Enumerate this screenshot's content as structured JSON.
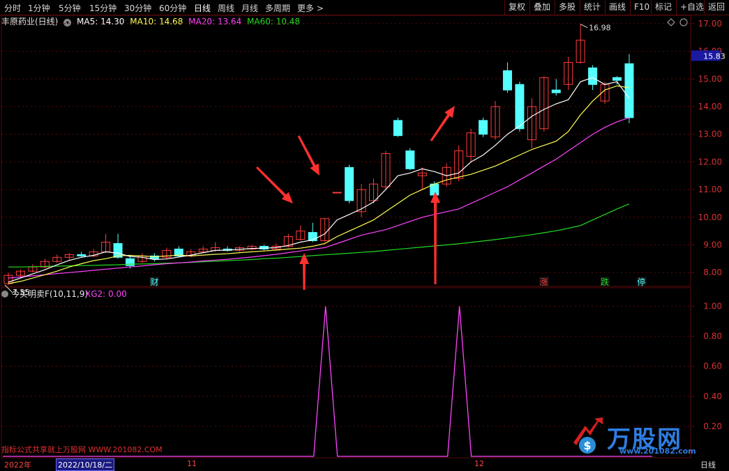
{
  "toolbar": {
    "tabs": [
      "分时",
      "1分钟",
      "5分钟",
      "15分钟",
      "30分钟",
      "60分钟",
      "日线",
      "周线",
      "月线",
      "多周期",
      "更多 >"
    ],
    "active_tab": "日线",
    "right_buttons": [
      "复权",
      "叠加",
      "多股",
      "统计",
      "画线",
      "F10",
      "标记",
      "+自选",
      "返回"
    ]
  },
  "info": {
    "stock_name": "丰原药业(日线)",
    "ma5": "MA5: 14.30",
    "ma10": "MA10: 14.68",
    "ma20": "MA20: 13.64",
    "ma60": "MA60: 10.48"
  },
  "indicator": {
    "name": "今买明卖F(10,11,9)",
    "series_label": "XG2: 0.00"
  },
  "colors": {
    "up": "#ff3c3c",
    "down": "#54ffff",
    "ma5": "#ffffff",
    "ma10": "#ffff55",
    "ma20": "#ff44ff",
    "ma60": "#22dd22",
    "grid": "#5a0a0a",
    "arrow": "#ff3030"
  },
  "promo_text": "指标公式共享就上万股网 WWW.201082.COM",
  "watermark": {
    "brand": "万股网",
    "url": "www.201082.com"
  },
  "bottom": {
    "year": "2022年",
    "date": "2022/10/18/二",
    "m11": "11",
    "m12": "12",
    "period": "日线"
  },
  "chart_data": {
    "type": "candlestick",
    "price_axis": {
      "ylim": [
        7.5,
        17.3
      ],
      "ticks": [
        "17.00",
        "16.00",
        "15.00",
        "14.00",
        "13.00",
        "12.00",
        "11.00",
        "10.00",
        "9.00",
        "8.00"
      ]
    },
    "current_price": "15.83",
    "high_label": "16.98",
    "low_label": "7.55",
    "candles": [
      {
        "o": 7.6,
        "c": 7.9,
        "h": 8.0,
        "l": 7.55
      },
      {
        "o": 7.9,
        "c": 8.05,
        "h": 8.1,
        "l": 7.85
      },
      {
        "o": 8.05,
        "c": 8.2,
        "h": 8.3,
        "l": 8.0
      },
      {
        "o": 8.2,
        "c": 8.4,
        "h": 8.5,
        "l": 8.15
      },
      {
        "o": 8.4,
        "c": 8.55,
        "h": 8.65,
        "l": 8.35
      },
      {
        "o": 8.55,
        "c": 8.65,
        "h": 8.7,
        "l": 8.45
      },
      {
        "o": 8.65,
        "c": 8.6,
        "h": 8.75,
        "l": 8.55
      },
      {
        "o": 8.6,
        "c": 8.75,
        "h": 8.85,
        "l": 8.55
      },
      {
        "o": 8.75,
        "c": 9.1,
        "h": 9.4,
        "l": 8.7
      },
      {
        "o": 9.05,
        "c": 8.55,
        "h": 9.4,
        "l": 8.5
      },
      {
        "o": 8.5,
        "c": 8.25,
        "h": 8.6,
        "l": 8.15
      },
      {
        "o": 8.4,
        "c": 8.6,
        "h": 8.7,
        "l": 8.35
      },
      {
        "o": 8.6,
        "c": 8.5,
        "h": 8.7,
        "l": 8.4
      },
      {
        "o": 8.55,
        "c": 8.8,
        "h": 8.9,
        "l": 8.5
      },
      {
        "o": 8.85,
        "c": 8.6,
        "h": 8.95,
        "l": 8.55
      },
      {
        "o": 8.6,
        "c": 8.75,
        "h": 8.85,
        "l": 8.55
      },
      {
        "o": 8.75,
        "c": 8.85,
        "h": 8.95,
        "l": 8.7
      },
      {
        "o": 8.8,
        "c": 8.9,
        "h": 9.1,
        "l": 8.75
      },
      {
        "o": 8.85,
        "c": 8.8,
        "h": 8.95,
        "l": 8.75
      },
      {
        "o": 8.8,
        "c": 8.9,
        "h": 8.95,
        "l": 8.75
      },
      {
        "o": 8.85,
        "c": 8.95,
        "h": 9.0,
        "l": 8.8
      },
      {
        "o": 8.95,
        "c": 8.85,
        "h": 9.0,
        "l": 8.8
      },
      {
        "o": 8.85,
        "c": 8.95,
        "h": 9.05,
        "l": 8.8
      },
      {
        "o": 8.95,
        "c": 9.3,
        "h": 9.4,
        "l": 8.9
      },
      {
        "o": 9.2,
        "c": 9.5,
        "h": 9.7,
        "l": 9.15
      },
      {
        "o": 9.45,
        "c": 9.15,
        "h": 9.8,
        "l": 9.1
      },
      {
        "o": 9.15,
        "c": 9.95,
        "h": 9.95,
        "l": 9.1
      },
      {
        "o": 10.9,
        "c": 10.9,
        "h": 10.9,
        "l": 10.9
      },
      {
        "o": 11.8,
        "c": 10.6,
        "h": 11.9,
        "l": 10.5
      },
      {
        "o": 10.2,
        "c": 11.0,
        "h": 11.2,
        "l": 10.0
      },
      {
        "o": 10.6,
        "c": 11.2,
        "h": 11.4,
        "l": 10.5
      },
      {
        "o": 11.1,
        "c": 12.3,
        "h": 12.4,
        "l": 11.0
      },
      {
        "o": 13.5,
        "c": 12.95,
        "h": 13.6,
        "l": 12.9
      },
      {
        "o": 12.4,
        "c": 11.75,
        "h": 12.5,
        "l": 11.7
      },
      {
        "o": 11.5,
        "c": 11.6,
        "h": 11.8,
        "l": 11.0
      },
      {
        "o": 11.2,
        "c": 10.8,
        "h": 11.3,
        "l": 10.4
      },
      {
        "o": 11.2,
        "c": 11.8,
        "h": 11.95,
        "l": 11.1
      },
      {
        "o": 11.4,
        "c": 12.4,
        "h": 12.6,
        "l": 11.3
      },
      {
        "o": 12.2,
        "c": 13.05,
        "h": 13.2,
        "l": 12.0
      },
      {
        "o": 13.5,
        "c": 13.0,
        "h": 13.6,
        "l": 12.9
      },
      {
        "o": 12.9,
        "c": 14.0,
        "h": 14.2,
        "l": 12.8
      },
      {
        "o": 15.3,
        "c": 14.6,
        "h": 15.6,
        "l": 14.5
      },
      {
        "o": 14.8,
        "c": 13.2,
        "h": 14.9,
        "l": 13.1
      },
      {
        "o": 12.8,
        "c": 14.0,
        "h": 14.3,
        "l": 12.5
      },
      {
        "o": 13.2,
        "c": 15.05,
        "h": 15.1,
        "l": 13.1
      },
      {
        "o": 14.6,
        "c": 14.5,
        "h": 15.0,
        "l": 14.4
      },
      {
        "o": 14.8,
        "c": 15.6,
        "h": 15.8,
        "l": 14.6
      },
      {
        "o": 15.6,
        "c": 16.4,
        "h": 16.98,
        "l": 15.55
      },
      {
        "o": 15.4,
        "c": 14.8,
        "h": 15.5,
        "l": 14.6
      },
      {
        "o": 14.2,
        "c": 14.8,
        "h": 14.9,
        "l": 14.1
      },
      {
        "o": 15.05,
        "c": 14.95,
        "h": 15.1,
        "l": 14.8
      },
      {
        "o": 15.55,
        "c": 13.6,
        "h": 15.9,
        "l": 13.4
      }
    ],
    "ma5": [
      7.65,
      7.8,
      7.95,
      8.1,
      8.28,
      8.44,
      8.55,
      8.62,
      8.75,
      8.7,
      8.58,
      8.55,
      8.47,
      8.49,
      8.56,
      8.63,
      8.72,
      8.8,
      8.81,
      8.84,
      8.87,
      8.88,
      8.9,
      8.98,
      9.1,
      9.18,
      9.4,
      9.9,
      10.1,
      10.3,
      10.55,
      11.0,
      11.5,
      11.6,
      11.75,
      11.65,
      11.5,
      11.6,
      12.0,
      12.25,
      12.6,
      13.0,
      13.3,
      13.65,
      13.9,
      14.1,
      14.25,
      14.9,
      15.05,
      14.8,
      14.9,
      14.3
    ],
    "ma10": [
      7.6,
      7.68,
      7.8,
      7.92,
      8.05,
      8.2,
      8.32,
      8.43,
      8.5,
      8.6,
      8.62,
      8.6,
      8.57,
      8.6,
      8.63,
      8.6,
      8.63,
      8.66,
      8.68,
      8.72,
      8.75,
      8.78,
      8.81,
      8.85,
      8.88,
      8.95,
      9.05,
      9.3,
      9.5,
      9.7,
      9.9,
      10.2,
      10.5,
      10.8,
      11.0,
      11.2,
      11.35,
      11.45,
      11.55,
      11.7,
      11.85,
      12.05,
      12.25,
      12.45,
      12.6,
      12.75,
      13.1,
      13.7,
      14.2,
      14.6,
      14.75,
      14.68
    ],
    "ma20": [
      7.8,
      7.84,
      7.88,
      7.92,
      7.96,
      8.0,
      8.04,
      8.08,
      8.12,
      8.16,
      8.2,
      8.24,
      8.28,
      8.32,
      8.35,
      8.38,
      8.42,
      8.45,
      8.48,
      8.52,
      8.56,
      8.61,
      8.66,
      8.72,
      8.78,
      8.84,
      8.9,
      9.05,
      9.2,
      9.35,
      9.45,
      9.55,
      9.7,
      9.85,
      10.0,
      10.1,
      10.2,
      10.3,
      10.5,
      10.7,
      10.9,
      11.1,
      11.35,
      11.6,
      11.85,
      12.1,
      12.4,
      12.7,
      13.0,
      13.25,
      13.45,
      13.6
    ],
    "ma60": [
      8.2,
      8.2,
      8.21,
      8.22,
      8.23,
      8.24,
      8.25,
      8.26,
      8.27,
      8.28,
      8.3,
      8.31,
      8.32,
      8.34,
      8.35,
      8.37,
      8.39,
      8.41,
      8.43,
      8.45,
      8.47,
      8.5,
      8.52,
      8.55,
      8.58,
      8.61,
      8.64,
      8.67,
      8.7,
      8.73,
      8.76,
      8.8,
      8.84,
      8.88,
      8.92,
      8.96,
      9.0,
      9.04,
      9.09,
      9.14,
      9.19,
      9.25,
      9.31,
      9.37,
      9.44,
      9.51,
      9.6,
      9.7,
      9.9,
      10.1,
      10.3,
      10.48
    ],
    "markers": [
      {
        "index": 12,
        "label": "财",
        "color": "#54ffff"
      },
      {
        "index": 44,
        "label": "涨",
        "color": "#ff3c3c"
      },
      {
        "index": 49,
        "label": "跌",
        "color": "#22dd22"
      },
      {
        "index": 52,
        "label": "停",
        "color": "#54ffff"
      }
    ],
    "indicator_axis": {
      "ylim": [
        0,
        1.1
      ],
      "ticks": [
        "1.00",
        "0.80",
        "0.60",
        "0.40",
        "0.20"
      ]
    },
    "xg2_signal": [
      {
        "index": 26,
        "value": 1.0
      },
      {
        "index": 37,
        "value": 1.0
      }
    ]
  }
}
